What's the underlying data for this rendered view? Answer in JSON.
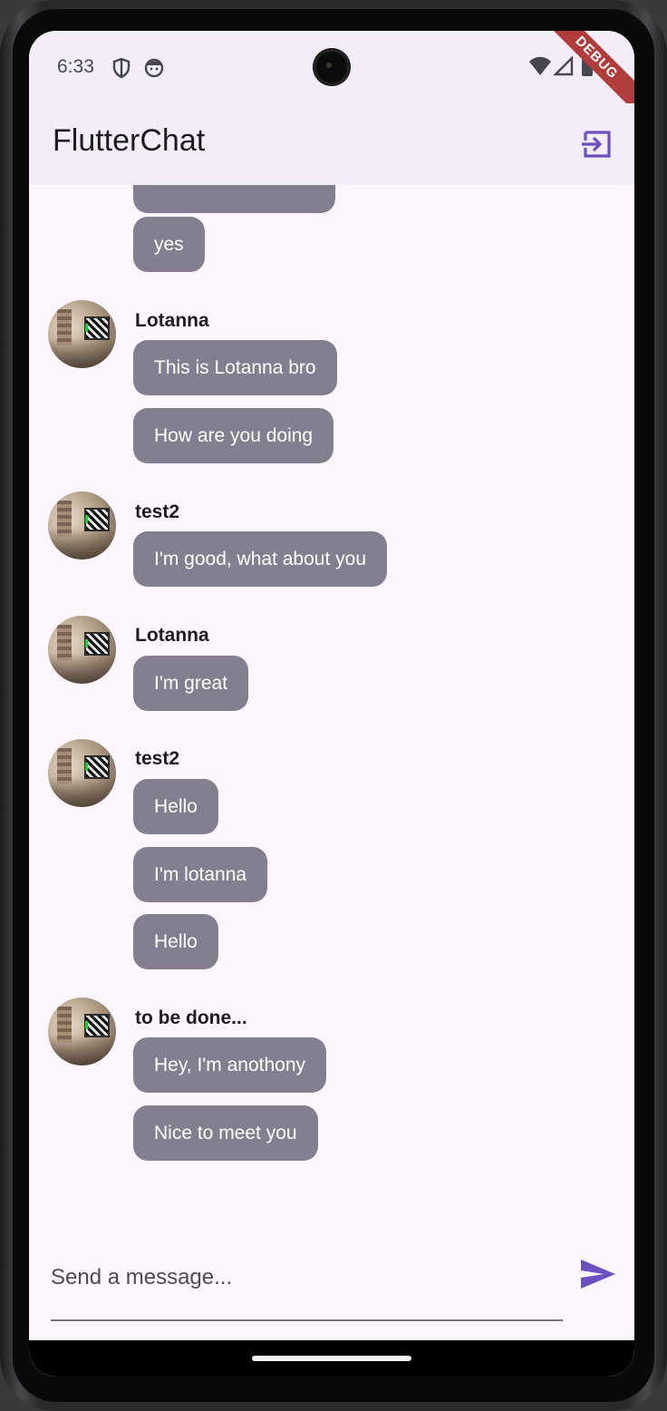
{
  "status_bar": {
    "time": "6:33",
    "debug_label": "DEBUG"
  },
  "app_bar": {
    "title": "FlutterChat",
    "logout_icon": "logout-icon"
  },
  "colors": {
    "bubble": "#847f90",
    "app_bar_bg": "#f3edf9",
    "accent": "#6d4fc2",
    "screen_bg": "#fdf7fd"
  },
  "messages": [
    {
      "sender": null,
      "text": ""
    },
    {
      "sender": null,
      "text": "yes"
    },
    {
      "sender": "Lotanna",
      "text": "This is Lotanna bro"
    },
    {
      "sender": null,
      "text": "How are you doing"
    },
    {
      "sender": "test2",
      "text": "I'm good, what about you"
    },
    {
      "sender": "Lotanna",
      "text": "I'm great"
    },
    {
      "sender": "test2",
      "text": "Hello"
    },
    {
      "sender": null,
      "text": "I'm lotanna"
    },
    {
      "sender": null,
      "text": "Hello"
    },
    {
      "sender": "to be done...",
      "text": "Hey, I'm anothony"
    },
    {
      "sender": null,
      "text": "Nice to meet you"
    }
  ],
  "composer": {
    "placeholder": "Send a message...",
    "value": "",
    "send_icon": "send-icon"
  }
}
